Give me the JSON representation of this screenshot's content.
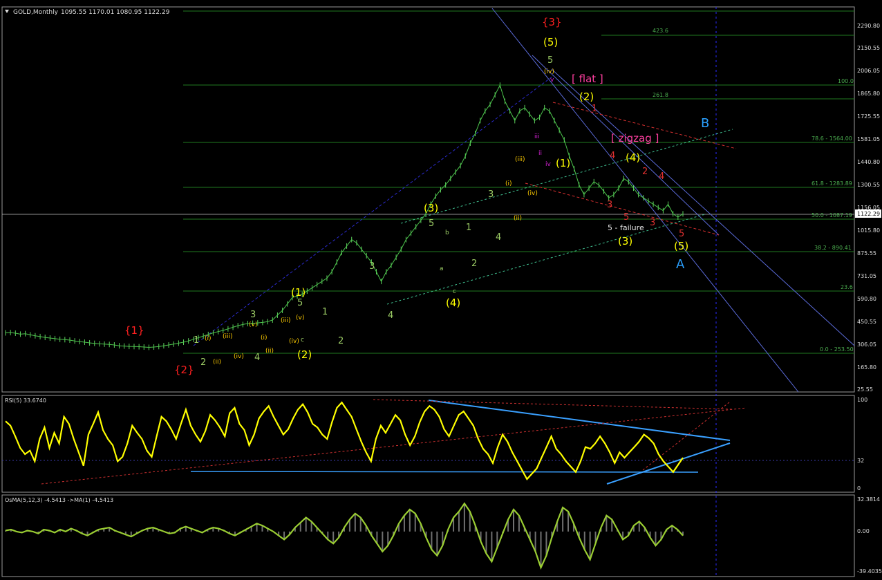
{
  "header": {
    "symbol": "GOLD,Monthly",
    "ohlc": "1095.55 1170.01 1080.95 1122.29"
  },
  "price_axis": {
    "ticks": [
      "2290.80",
      "2150.55",
      "2006.05",
      "1865.80",
      "1725.55",
      "1581.05",
      "1440.80",
      "1300.55",
      "1156.05",
      "1015.80",
      "875.55",
      "731.05",
      "590.80",
      "450.55",
      "306.05",
      "165.80",
      "25.55"
    ],
    "current": "1122.29"
  },
  "fib_levels": [
    {
      "label": "100.0"
    },
    {
      "label": "78.6 - 1564.00"
    },
    {
      "label": "61.8 - 1283.89"
    },
    {
      "label": "50.0 - 1087.19"
    },
    {
      "label": "38.2 - 890.41"
    },
    {
      "label": "23.6"
    },
    {
      "label": "0.0 - 253.50"
    },
    {
      "label": "423.6"
    },
    {
      "label": "261.8"
    }
  ],
  "wave_labels": {
    "red": [
      "{1}",
      "{2}",
      "{3}"
    ],
    "yellow": [
      "(1)",
      "(2)",
      "(3)",
      "(4)",
      "(5)",
      "(1)",
      "(2)",
      "(3)",
      "(4)",
      "(5)"
    ],
    "green": [
      "1",
      "2",
      "3",
      "4",
      "5",
      "1",
      "2",
      "3",
      "4",
      "5",
      "a",
      "b",
      "c"
    ],
    "roman": [
      "(i)",
      "(ii)",
      "(iii)",
      "(iv)",
      "(v)",
      "(i)",
      "(ii)",
      "(iii)",
      "(iv)",
      "(v)",
      "(i)",
      "(ii)",
      "(iii)",
      "(iv)"
    ],
    "magenta": [
      "[ flat ]",
      "[ zigzag ]",
      "iii",
      "iv",
      "v",
      "ii"
    ],
    "failure": "5 - failure",
    "blue": [
      "A",
      "B"
    ]
  },
  "rsi": {
    "title": "RSI(5) 33.6740",
    "ticks": [
      "100",
      "32",
      "0"
    ]
  },
  "osma": {
    "title": "OsMA(5,12,3) -4.5413   ->MA(1) -4.5413",
    "ticks": [
      "32.3814",
      "0.00",
      "-39.4035"
    ]
  },
  "chart_data": {
    "type": "line",
    "title": "GOLD,Monthly",
    "ylim": [
      25.55,
      2290.8
    ],
    "price": [
      380,
      382,
      378,
      372,
      375,
      368,
      362,
      357,
      352,
      348,
      344,
      340,
      338,
      335,
      330,
      326,
      322,
      318,
      315,
      312,
      310,
      308,
      305,
      300,
      298,
      296,
      295,
      294,
      292,
      290,
      292,
      295,
      300,
      305,
      310,
      316,
      322,
      330,
      340,
      350,
      360,
      370,
      380,
      388,
      395,
      405,
      415,
      425,
      432,
      438,
      440,
      442,
      445,
      450,
      460,
      490,
      520,
      560,
      600,
      610,
      620,
      640,
      660,
      680,
      700,
      720,
      760,
      820,
      880,
      920,
      960,
      940,
      900,
      860,
      820,
      760,
      700,
      760,
      800,
      850,
      900,
      960,
      1000,
      1040,
      1080,
      1120,
      1180,
      1230,
      1270,
      1300,
      1340,
      1380,
      1420,
      1480,
      1560,
      1620,
      1700,
      1760,
      1800,
      1860,
      1920,
      1820,
      1760,
      1700,
      1760,
      1780,
      1740,
      1700,
      1720,
      1780,
      1760,
      1700,
      1640,
      1580,
      1480,
      1400,
      1300,
      1240,
      1280,
      1320,
      1300,
      1260,
      1220,
      1240,
      1280,
      1340,
      1320,
      1280,
      1240,
      1220,
      1200,
      1180,
      1160,
      1140,
      1180,
      1120,
      1100,
      1120
    ],
    "rsi": [
      75,
      70,
      58,
      45,
      38,
      42,
      30,
      55,
      68,
      45,
      62,
      50,
      80,
      72,
      55,
      40,
      25,
      60,
      72,
      85,
      65,
      55,
      48,
      30,
      35,
      50,
      70,
      62,
      55,
      42,
      35,
      58,
      80,
      75,
      66,
      55,
      72,
      88,
      70,
      60,
      52,
      64,
      82,
      76,
      68,
      58,
      84,
      90,
      72,
      65,
      48,
      60,
      78,
      86,
      92,
      80,
      70,
      60,
      66,
      78,
      88,
      94,
      85,
      72,
      68,
      60,
      55,
      74,
      90,
      96,
      88,
      80,
      66,
      52,
      40,
      30,
      55,
      70,
      62,
      72,
      82,
      76,
      60,
      48,
      58,
      74,
      86,
      92,
      88,
      80,
      66,
      58,
      70,
      82,
      86,
      78,
      70,
      55,
      44,
      38,
      28,
      46,
      60,
      52,
      40,
      30,
      20,
      10,
      16,
      22,
      34,
      46,
      58,
      44,
      38,
      30,
      24,
      18,
      30,
      46,
      44,
      50,
      58,
      50,
      40,
      28,
      40,
      34,
      40,
      46,
      52,
      60,
      56,
      50,
      38,
      30,
      24,
      18,
      26,
      34
    ],
    "rsi_ylim": [
      0,
      100
    ],
    "osma": [
      1,
      2,
      0,
      -1,
      1,
      0,
      -2,
      2,
      1,
      -1,
      2,
      0,
      3,
      1,
      -2,
      -4,
      -1,
      2,
      3,
      4,
      1,
      -1,
      -3,
      -5,
      -2,
      1,
      3,
      4,
      2,
      0,
      -2,
      -1,
      3,
      5,
      3,
      1,
      -1,
      2,
      4,
      3,
      1,
      -2,
      -4,
      -1,
      2,
      5,
      8,
      6,
      3,
      0,
      -4,
      -8,
      -3,
      4,
      9,
      14,
      10,
      4,
      -2,
      -8,
      -12,
      -6,
      4,
      12,
      18,
      14,
      6,
      -4,
      -12,
      -20,
      -14,
      -4,
      8,
      16,
      22,
      18,
      8,
      -6,
      -18,
      -24,
      -14,
      2,
      14,
      20,
      28,
      20,
      6,
      -10,
      -22,
      -30,
      -16,
      -2,
      12,
      22,
      16,
      4,
      -8,
      -20,
      -36,
      -24,
      -6,
      10,
      24,
      20,
      8,
      -6,
      -18,
      -28,
      -12,
      4,
      16,
      12,
      2,
      -8,
      -4,
      6,
      10,
      4,
      -6,
      -14,
      -8,
      2,
      6,
      2,
      -4
    ],
    "osma_ylim": [
      -39.4035,
      32.3814
    ]
  }
}
